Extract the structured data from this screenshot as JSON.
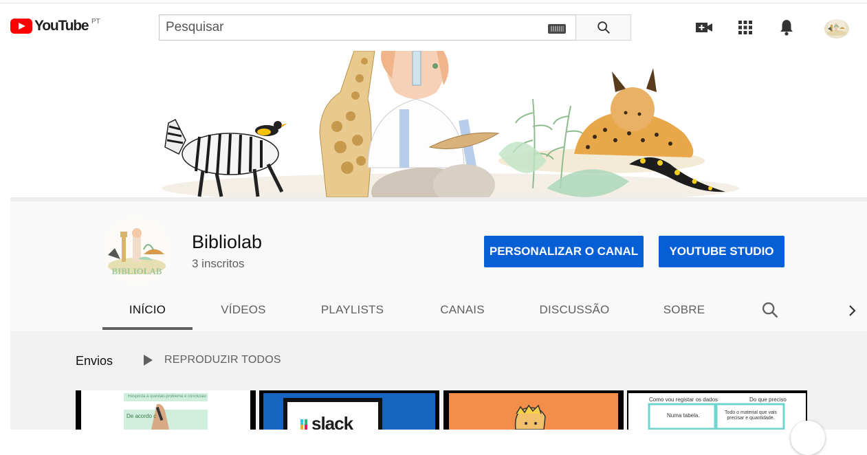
{
  "masthead": {
    "logo_text": "YouTube",
    "country_code": "PT",
    "search_placeholder": "Pesquisar",
    "icons": [
      "keyboard-icon",
      "search-icon",
      "create-video-icon",
      "apps-grid-icon",
      "notifications-bell-icon",
      "account-avatar"
    ]
  },
  "channel": {
    "name": "Bibliolab",
    "subscribers": "3 inscritos",
    "avatar_text": "BIBLIOLAB",
    "customize_label": "PERSONALIZAR O CANAL",
    "studio_label": "YOUTUBE STUDIO"
  },
  "tabs": [
    {
      "label": "INÍCIO",
      "active": true
    },
    {
      "label": "VÍDEOS",
      "active": false
    },
    {
      "label": "PLAYLISTS",
      "active": false
    },
    {
      "label": "CANAIS",
      "active": false
    },
    {
      "label": "DISCUSSÃO",
      "active": false
    },
    {
      "label": "SOBRE",
      "active": false
    }
  ],
  "uploads": {
    "title": "Envios",
    "play_all_label": "REPRODUZIR TODOS",
    "thumbnails": [
      {
        "text_top": "Resposta à questão-problema e conclusão",
        "text_box": "De acordo c"
      },
      {
        "text": "slack"
      },
      {
        "text": ""
      },
      {
        "text_left": "Como vou registar os dados",
        "text_right": "Do que preciso",
        "cell1": "Numa tabela.",
        "cell2": "Todo o material que vais precisar e quantidade."
      }
    ]
  },
  "colors": {
    "brand_red": "#ff0000",
    "button_blue": "#065fd4",
    "header_bg": "#f9f9f9",
    "content_bg": "#f1f1f1"
  }
}
